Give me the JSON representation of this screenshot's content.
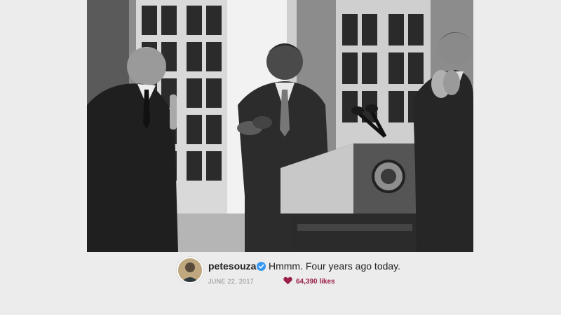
{
  "post": {
    "username": "petesouza",
    "caption": "Hmmm. Four years ago today.",
    "date": "JUNE 22, 2017",
    "likes": "64,390 likes",
    "verified": true
  },
  "icons": {
    "verified": "verified-badge-icon",
    "like": "heart-icon",
    "avatar": "profile-avatar"
  },
  "colors": {
    "verified": "#3897f0",
    "likes": "#9b1f4d",
    "background": "#ececec"
  }
}
